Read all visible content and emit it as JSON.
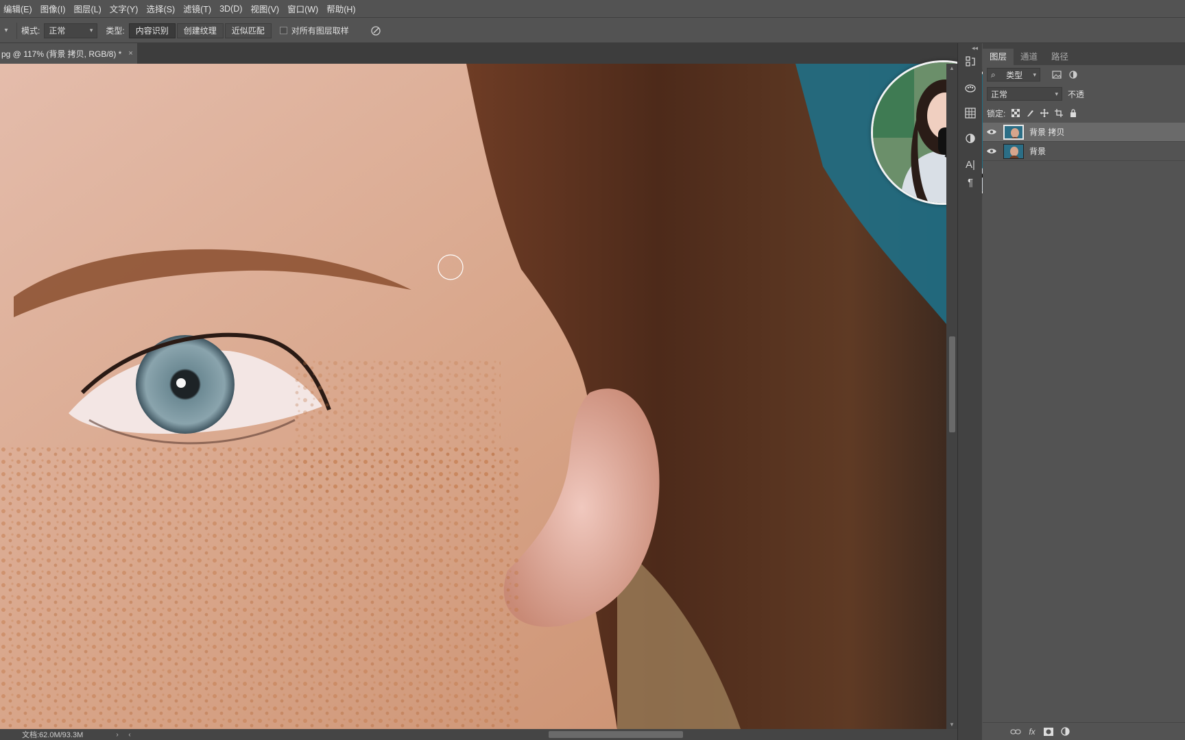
{
  "menu": {
    "items": [
      "编辑(E)",
      "图像(I)",
      "图层(L)",
      "文字(Y)",
      "选择(S)",
      "滤镜(T)",
      "3D(D)",
      "视图(V)",
      "窗口(W)",
      "帮助(H)"
    ]
  },
  "options": {
    "mode_label": "模式:",
    "mode_value": "正常",
    "type_label": "类型:",
    "type_buttons": [
      "内容识别",
      "创建纹理",
      "近似匹配"
    ],
    "sample_all_label": "对所有图层取样"
  },
  "document": {
    "tab_title": "pg @ 117% (背景 拷贝, RGB/8) *",
    "close_glyph": "×"
  },
  "status": {
    "doc_size": "文档:62.0M/93.3M",
    "arrow": "›",
    "left_arrow": "‹"
  },
  "panel": {
    "tabs": [
      "图层",
      "通道",
      "路径"
    ],
    "filter_value": "类型",
    "blend_mode": "正常",
    "opacity_label": "不透",
    "lock_label": "锁定:",
    "layers": [
      {
        "name": "背景 拷贝",
        "selected": true,
        "visible": true
      },
      {
        "name": "背景",
        "selected": false,
        "visible": true
      }
    ],
    "bottom_icons": [
      "link-icon",
      "fx-icon",
      "mask-icon",
      "adjustment-icon"
    ],
    "fx_text": "fx"
  },
  "side_tools": {
    "icons": [
      "history-icon",
      "palette-icon",
      "grid-icon",
      "adjustments-icon",
      "character-icon",
      "paragraph-icon"
    ],
    "character_glyph": "A|",
    "paragraph_glyph": "¶"
  }
}
